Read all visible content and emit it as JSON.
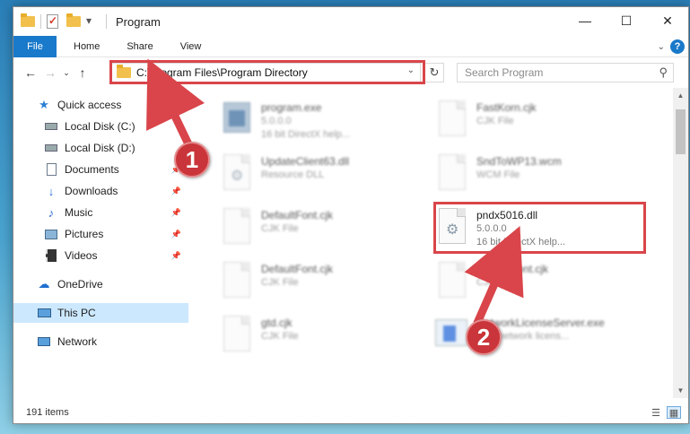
{
  "window": {
    "title": "Program",
    "controls": {
      "minimize": "—",
      "maximize": "☐",
      "close": "✕"
    }
  },
  "ribbon": {
    "tabs": [
      {
        "label": "File"
      },
      {
        "label": "Home"
      },
      {
        "label": "Share"
      },
      {
        "label": "View"
      }
    ],
    "help": "?"
  },
  "nav": {
    "address": "C:\\Program Files\\Program Directory",
    "search_placeholder": "Search Program"
  },
  "sidebar": {
    "items": [
      {
        "label": "Quick access",
        "icon": "star-icon"
      },
      {
        "label": "Local Disk (C:)",
        "icon": "drive-icon"
      },
      {
        "label": "Local Disk (D:)",
        "icon": "drive-icon"
      },
      {
        "label": "Documents",
        "icon": "documents-icon",
        "pinned": true
      },
      {
        "label": "Downloads",
        "icon": "downloads-icon",
        "pinned": true
      },
      {
        "label": "Music",
        "icon": "music-icon",
        "pinned": true
      },
      {
        "label": "Pictures",
        "icon": "pictures-icon",
        "pinned": true
      },
      {
        "label": "Videos",
        "icon": "videos-icon",
        "pinned": true
      },
      {
        "label": "OneDrive",
        "icon": "onedrive-icon"
      },
      {
        "label": "This PC",
        "icon": "pc-icon",
        "selected": true
      },
      {
        "label": "Network",
        "icon": "network-icon"
      }
    ]
  },
  "files": [
    {
      "name": "program.exe",
      "line2": "5.0.0.0",
      "line3": "16 bit DirectX help...",
      "icon": "exe-icon"
    },
    {
      "name": "FastKorn.cjk",
      "line2": "CJK File",
      "line3": "",
      "icon": "file-icon"
    },
    {
      "name": "UpdateClient63.dll",
      "line2": "Resource DLL",
      "line3": "",
      "icon": "dll-icon"
    },
    {
      "name": "SndToWP13.wcm",
      "line2": "WCM File",
      "line3": "",
      "icon": "file-icon"
    },
    {
      "name": "DefaultFont.cjk",
      "line2": "CJK File",
      "line3": "",
      "icon": "file-icon"
    },
    {
      "name": "pndx5016.dll",
      "line2": "5.0.0.0",
      "line3": "16 bit DirectX help...",
      "icon": "dll-icon",
      "highlighted": true
    },
    {
      "name": "DefaultFont.cjk",
      "line2": "CJK File",
      "line3": "",
      "icon": "file-icon"
    },
    {
      "name": "DefaultFont.cjk",
      "line2": "CJK File",
      "line3": "",
      "icon": "file-icon"
    },
    {
      "name": "gtd.cjk",
      "line2": "CJK File",
      "line3": "",
      "icon": "file-icon"
    },
    {
      "name": "NetworkLicenseServer.exe",
      "line2": "3DY network licens...",
      "line3": "",
      "icon": "network-exe-icon"
    }
  ],
  "status": {
    "count": "191 items"
  },
  "annotations": {
    "step1": "1",
    "step2": "2",
    "highlight_color": "#d9454a"
  }
}
